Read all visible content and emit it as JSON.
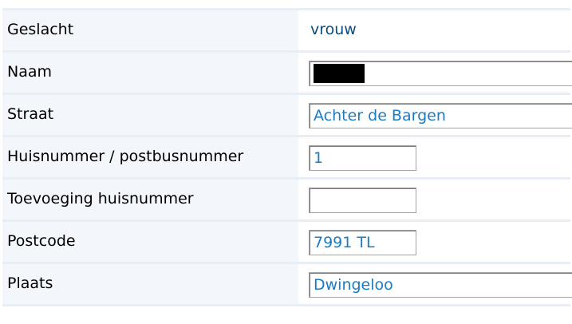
{
  "form": {
    "gender": {
      "label": "Geslacht",
      "value": "vrouw"
    },
    "name": {
      "label": "Naam",
      "value": ""
    },
    "street": {
      "label": "Straat",
      "value": "Achter de Bargen"
    },
    "house_number": {
      "label": "Huisnummer / postbusnummer",
      "value": "1"
    },
    "house_number_addition": {
      "label": "Toevoeging huisnummer",
      "value": ""
    },
    "postcode": {
      "label": "Postcode",
      "value": "7991 TL"
    },
    "city": {
      "label": "Plaats",
      "value": "Dwingeloo"
    }
  },
  "colors": {
    "label_background": "#f3f7fb",
    "row_divider": "#e8eef5",
    "static_value_text": "#0b4c7a",
    "input_value_text": "#1a7cc2",
    "redaction": "#000000"
  }
}
